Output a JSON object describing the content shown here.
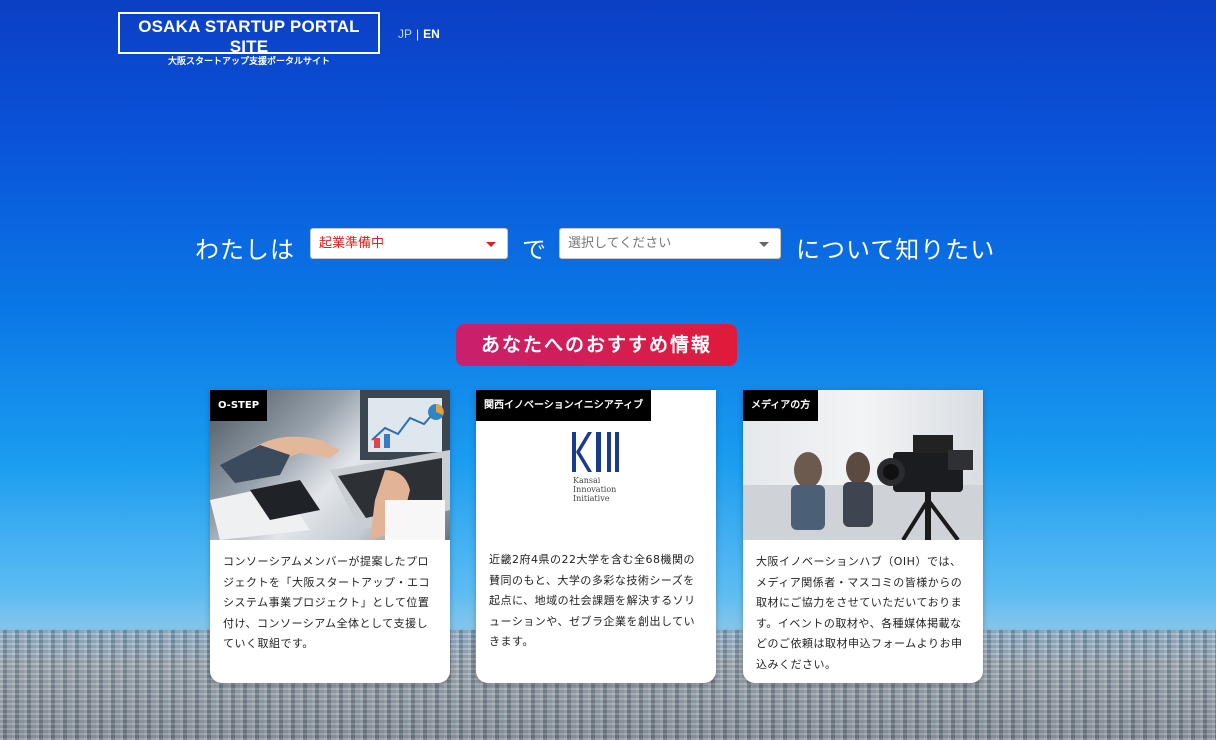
{
  "header": {
    "logo_title": "OSAKA STARTUP PORTAL SITE",
    "logo_subtitle": "大阪スタートアップ支援ポータルサイト",
    "lang_jp": "JP",
    "lang_sep": "|",
    "lang_en": "EN"
  },
  "selector": {
    "prefix": "わたしは",
    "stage_value": "起業準備中",
    "middle": "で",
    "topic_placeholder": "選択してください",
    "suffix": "について知りたい"
  },
  "recommend_label": "あなたへのおすすめ情報",
  "cards": [
    {
      "tag": "O-STEP",
      "text": "コンソーシアムメンバーが提案したプロジェクトを「大阪スタートアップ・エコシステム事業プロジェクト」として位置付け、コンソーシアム全体として支援していく取組です。"
    },
    {
      "tag": "関西イノベーションイニシアティブ",
      "logo_letters": "KSII",
      "logo_caption": "Kansai Innovation Initiative",
      "text": "近畿2府4県の22大学を含む全68機関の賛同のもと、大学の多彩な技術シーズを起点に、地域の社会課題を解決するソリューションや、ゼブラ企業を創出していきます。"
    },
    {
      "tag": "メディアの方",
      "text": "大阪イノベーションハブ（OIH）では、メディア関係者・マスコミの皆様からの取材にご協力をさせていただいております。イベントの取材や、各種媒体掲載などのご依頼は取材申込フォームよりお申込みください。"
    }
  ],
  "colors": {
    "accent_red": "#d8221e",
    "button_gradient_start": "#c8206e",
    "button_gradient_end": "#e01b3a"
  }
}
